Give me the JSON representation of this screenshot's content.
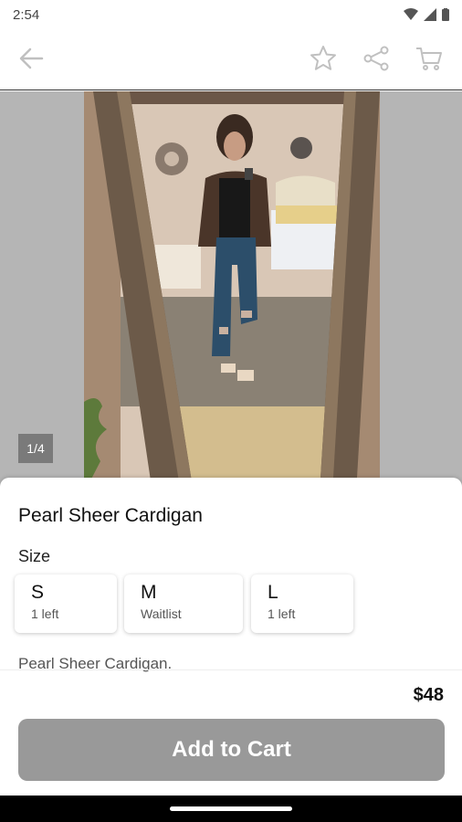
{
  "status": {
    "time": "2:54",
    "icons": [
      "wifi-icon",
      "signal-icon",
      "battery-icon"
    ]
  },
  "appbar": {
    "icons": [
      "back-arrow-icon",
      "star-icon",
      "share-icon",
      "cart-icon"
    ]
  },
  "gallery": {
    "counter": "1/4",
    "image": "product-photo-mirror-selfie"
  },
  "product": {
    "name": "Pearl Sheer Cardigan",
    "size_label": "Size",
    "sizes": [
      {
        "size": "S",
        "availability": "1 left"
      },
      {
        "size": "M",
        "availability": "Waitlist"
      },
      {
        "size": "L",
        "availability": "1 left"
      }
    ],
    "description": "Pearl Sheer Cardigan.",
    "price": "$48"
  },
  "actions": {
    "add_to_cart": "Add to Cart"
  },
  "colors": {
    "button": "#999999",
    "accent_icon": "#c0c0c0",
    "gallery_bg": "#b5b5b5"
  }
}
